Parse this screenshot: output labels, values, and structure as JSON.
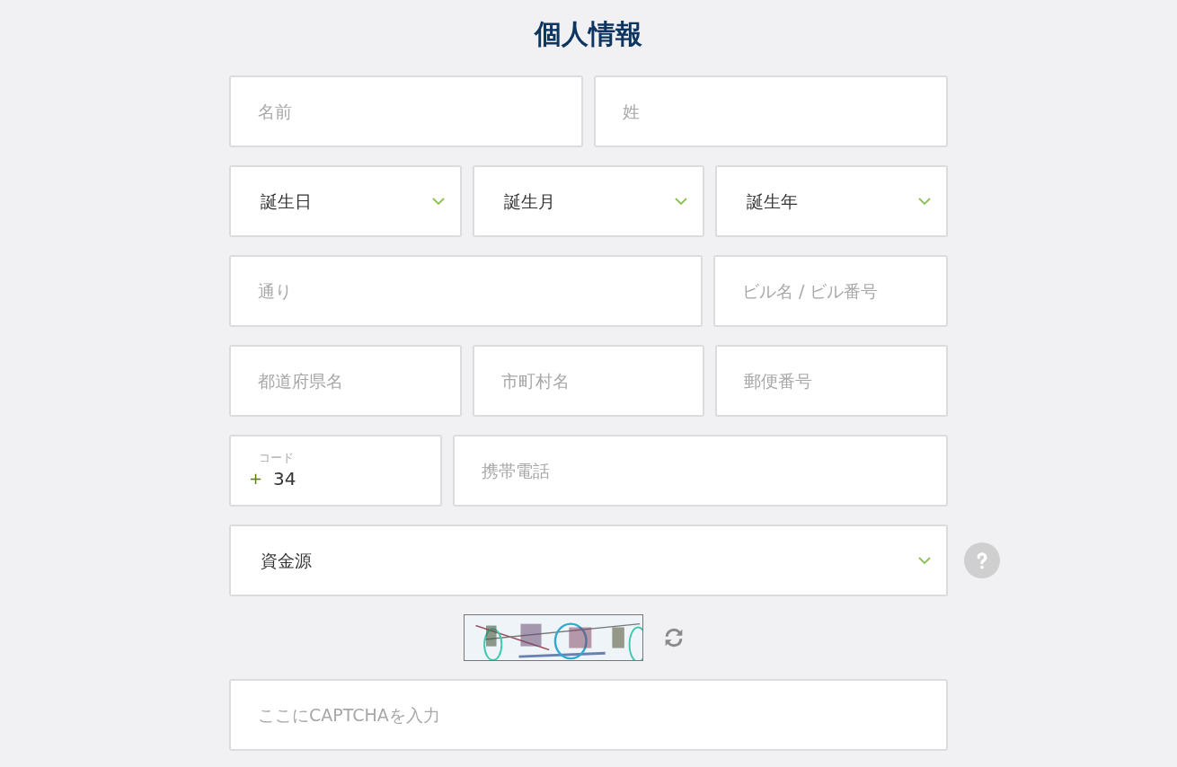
{
  "title": "個人情報",
  "rows": [
    [
      {
        "kind": "input",
        "placeholder": "名前"
      },
      {
        "kind": "input",
        "placeholder": "姓"
      }
    ],
    [
      {
        "kind": "select",
        "value": "誕生日"
      },
      {
        "kind": "select",
        "value": "誕生月"
      },
      {
        "kind": "select",
        "value": "誕生年"
      }
    ],
    [
      {
        "kind": "input",
        "placeholder": "通り"
      },
      {
        "kind": "input",
        "placeholder": "ビル名 / ビル番号"
      }
    ],
    [
      {
        "kind": "input",
        "placeholder": "都道府県名"
      },
      {
        "kind": "input",
        "placeholder": "市町村名"
      },
      {
        "kind": "input",
        "placeholder": "郵便番号"
      }
    ],
    [
      {
        "kind": "code",
        "label": "コード",
        "prefix": "+",
        "value": "34"
      },
      {
        "kind": "input",
        "placeholder": "携帯電話"
      }
    ],
    [
      {
        "kind": "select",
        "value": "資金源",
        "help": true
      }
    ]
  ],
  "captcha": {
    "kind": "picture"
  },
  "captcha_input": {
    "placeholder": "ここにCAPTCHAを入力"
  }
}
